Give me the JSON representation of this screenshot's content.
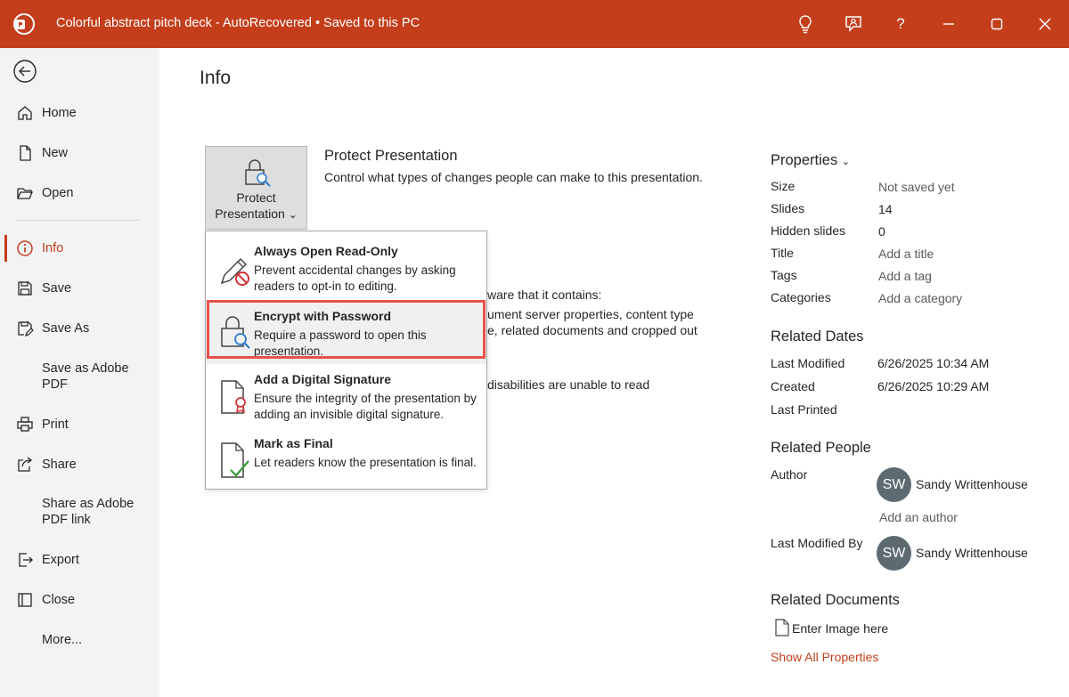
{
  "titlebar": {
    "title": "Colorful abstract pitch deck  -  AutoRecovered  •  Saved to this PC",
    "help_label": "?",
    "icons": [
      "powerpoint-icon",
      "lightbulb-icon",
      "feedback-icon",
      "help-icon",
      "minimize-icon",
      "maximize-icon",
      "close-icon"
    ]
  },
  "sidebar": {
    "items": [
      {
        "label": "Home",
        "icon": "home-icon"
      },
      {
        "label": "New",
        "icon": "new-document-icon"
      },
      {
        "label": "Open",
        "icon": "folder-open-icon"
      },
      {
        "label": "Info",
        "icon": "info-icon",
        "active": true
      },
      {
        "label": "Save",
        "icon": "save-icon"
      },
      {
        "label": "Save As",
        "icon": "save-as-icon"
      },
      {
        "label": "Save as Adobe PDF",
        "icon": ""
      },
      {
        "label": "Print",
        "icon": "print-icon"
      },
      {
        "label": "Share",
        "icon": "share-icon"
      },
      {
        "label": "Share as Adobe PDF link",
        "icon": ""
      },
      {
        "label": "Export",
        "icon": "export-icon"
      },
      {
        "label": "Close",
        "icon": "close-file-icon"
      },
      {
        "label": "More...",
        "icon": ""
      }
    ]
  },
  "main": {
    "title": "Info",
    "protect": {
      "button_label_line1": "Protect",
      "button_label_line2": "Presentation",
      "chevron": "⌄",
      "title": "Protect Presentation",
      "description": "Control what types of changes people can make to this presentation."
    },
    "background_text": [
      "ware that it contains:",
      "ument server properties, content type",
      "e, related documents and cropped out",
      "disabilities are unable to read"
    ]
  },
  "dropdown": {
    "items": [
      {
        "title": "Always Open Read-Only",
        "description": "Prevent accidental changes by asking readers to opt-in to editing."
      },
      {
        "title": "Encrypt with Password",
        "description": "Require a password to open this presentation."
      },
      {
        "title": "Add a Digital Signature",
        "description": "Ensure the integrity of the presentation by adding an invisible digital signature."
      },
      {
        "title": "Mark as Final",
        "description": "Let readers know the presentation is final."
      }
    ]
  },
  "properties": {
    "title": "Properties",
    "rows": [
      {
        "label": "Size",
        "value": "Not saved yet"
      },
      {
        "label": "Slides",
        "value": "14"
      },
      {
        "label": "Hidden slides",
        "value": "0"
      },
      {
        "label": "Title",
        "value": "Add a title"
      },
      {
        "label": "Tags",
        "value": "Add a tag"
      },
      {
        "label": "Categories",
        "value": "Add a category"
      }
    ]
  },
  "related_dates": {
    "title": "Related Dates",
    "rows": [
      {
        "label": "Last Modified",
        "value": "6/26/2025 10:34 AM"
      },
      {
        "label": "Created",
        "value": "6/26/2025 10:29 AM"
      },
      {
        "label": "Last Printed",
        "value": ""
      }
    ]
  },
  "related_people": {
    "title": "Related People",
    "author_label": "Author",
    "author_initials": "SW",
    "author_name": "Sandy Writtenhouse",
    "add_author": "Add an author",
    "last_modified_label": "Last Modified By",
    "modifier_initials": "SW",
    "modifier_name": "Sandy Writtenhouse"
  },
  "related_documents": {
    "title": "Related Documents",
    "item": "Enter Image here",
    "show_all": "Show All Properties"
  },
  "colors": {
    "accent": "#c43e1c",
    "sidebar_bg": "#f3f3f3",
    "highlight_border": "#e8524a",
    "avatar_bg": "#5d6a72"
  }
}
